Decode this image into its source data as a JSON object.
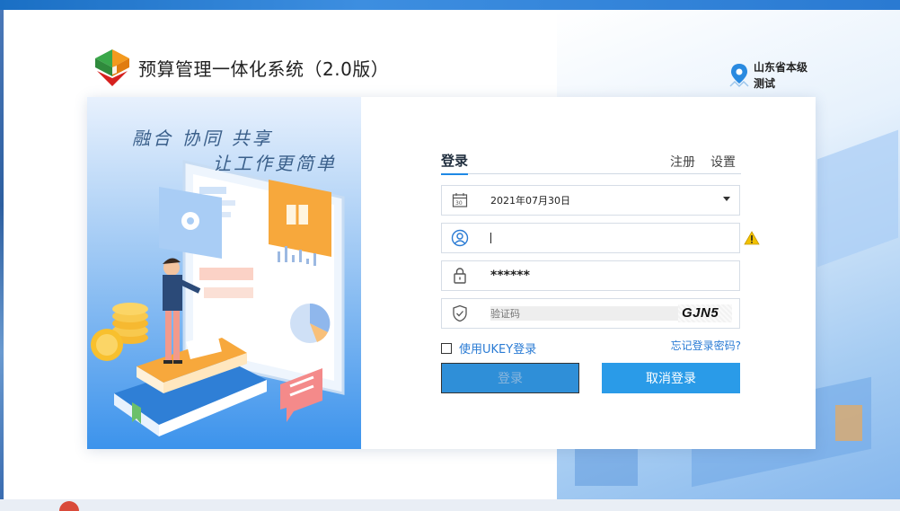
{
  "app": {
    "title": "预算管理一体化系统（2.0版）",
    "region": "山东省本级测试"
  },
  "illustration": {
    "slogan_line1": "融合 协同 共享",
    "slogan_line2": "让工作更简单"
  },
  "tabs": {
    "login": "登录",
    "register": "注册",
    "settings": "设置"
  },
  "form": {
    "date_value": "2021年07月30日",
    "username_value": "",
    "password_mask": "******",
    "captcha_placeholder": "验证码",
    "captcha_code": "GJN5",
    "ukey_label": "使用UKEY登录",
    "forgot_label": "忘记登录密码?",
    "login_button": "登录",
    "cancel_button": "取消登录"
  },
  "colors": {
    "accent": "#2a9be8",
    "link": "#2a7bd4",
    "warning": "#f2c200"
  },
  "icons": {
    "date": "calendar-icon",
    "user": "user-icon",
    "password": "lock-icon",
    "captcha": "shield-check-icon",
    "warning": "warning-icon",
    "region": "location-pin-icon"
  }
}
